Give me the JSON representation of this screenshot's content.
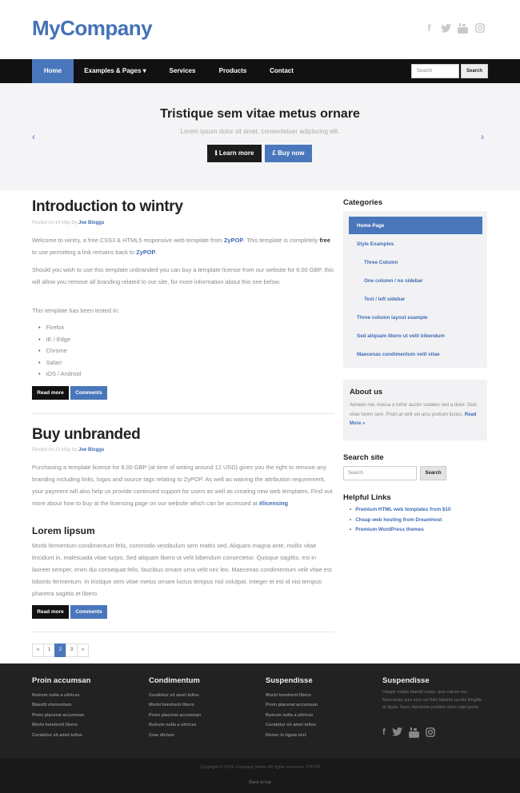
{
  "header": {
    "logo": "MyCompany",
    "social_icons": [
      "facebook-icon",
      "twitter-icon",
      "youtube-icon",
      "instagram-icon"
    ]
  },
  "nav": {
    "items": [
      "Home",
      "Examples & Pages ▾",
      "Services",
      "Products",
      "Contact"
    ],
    "search_placeholder": "Search",
    "search_button": "Search"
  },
  "hero": {
    "title": "Tristique sem vitae metus ornare",
    "subtitle": "Lorem ipsum dolor sit amet, consectetuer adipiscing elit.",
    "learn_more": "ℹ  Learn more",
    "buy_now": "£  Buy now"
  },
  "posts": [
    {
      "title": "Introduction to wintry",
      "meta_prefix": "Posted on 14 May by",
      "author": "Joe Bloggs",
      "p1a": "Welcome to wintry, a free CSS3 & HTML5 responsive web template from ",
      "p1link": "ZyPOP",
      "p1b": ". This template is completely ",
      "p1free": "free",
      "p1c": " to use permitting a link remains back to ",
      "p1link2": "ZyPOP",
      "p1d": ".",
      "p2": "Should you wish to use this template unbranded you can buy a template license from our website for 8.00 GBP, this will allow you remove all branding related to our site, for more information about this see below.",
      "p3": "This template has been tested in:",
      "list": [
        "Firefox",
        "IE / Edge",
        "Chrome",
        "Safari",
        "iOS / Android"
      ],
      "read_more": "Read more",
      "comments": "Comments"
    },
    {
      "title": "Buy unbranded",
      "meta_prefix": "Posted on 13 May by",
      "author": "Joe Bloggs",
      "p1": "Purchasing a template license for 8.00 GBP (at time of writing around 12 USD) gives you the right to remove any branding including links, logos and source tags relating to ZyPOP. As well as waiving the attribution requirement, your payment will also help us provide continued support for users as well as creating new web templates. Find out more about how to buy at the licensing page on our website which can be accessed at ",
      "p1link": "#licensing",
      "subheading": "Lorem lipsum",
      "p2": "Morbi fermentum condimentum felis, commodo vestibulum sem mattis sed. Aliquam magna ante, mollis vitae tincidunt in, malesuada vitae turpis. Sed aliquam libero ut velit bibendum consectetur. Quisque sagittis, est in laoreet semper, enim dui consequat felis, faucibus ornare urna velit nec leo. Maecenas condimentum velit vitae est lobortis fermentum. In tristique sem vitae metus ornare luctus tempus nisl volutpat. Integer et est id nisi tempus pharetra sagittis et libero.",
      "read_more": "Read more",
      "comments": "Comments"
    }
  ],
  "pagination": [
    "«",
    "1",
    "2",
    "3",
    "»"
  ],
  "sidebar": {
    "categories_title": "Categories",
    "categories": [
      "Home Page",
      "Style Examples",
      "Three Column",
      "One column / no sidebar",
      "Text / left sidebar",
      "Three column layout example",
      "Sed aliquam libero ut velit bibendum",
      "Maecenas condimentum velit vitae"
    ],
    "about_title": "About us",
    "about_text": "Aenean nec massa a tortor auctor sodales sed a dolor. Duis vitae lorem sem. Proin at velit vel arcu pretium luctus.",
    "about_link": "Read More »",
    "search_title": "Search site",
    "search_placeholder": "Search",
    "search_button": "Search",
    "links_title": "Helpful Links",
    "links": [
      "Premium HTML web templates from $10",
      "Cheap web hosting from Dreamhost",
      "Premium WordPress themes"
    ]
  },
  "footer": {
    "columns": [
      {
        "title": "Proin accumsan",
        "items": [
          "Rutrum nulla a ultrices",
          "Blandit elementum",
          "Proin placerat accumsan",
          "Morbi hendrerit libero",
          "Curabitur sit amet tellus"
        ]
      },
      {
        "title": "Condimentum",
        "items": [
          "Curabitur sit amet tellus",
          "Morbi hendrerit libero",
          "Proin placerat accumsan",
          "Rutrum nulla a ultrices",
          "Cras dictum"
        ]
      },
      {
        "title": "Suspendisse",
        "items": [
          "Morbi hendrerit libero",
          "Proin placerat accumsan",
          "Rutrum nulla a ultrices",
          "Curabitur sit amet tellus",
          "Donec in ligula nisl."
        ]
      }
    ],
    "col4_title": "Suspendisse",
    "col4_text": "Integer mattis blandit turpis, quis rutrum est. Maecenas quis arcu vel felis lobortis iaculis fringilla at ligula. Nunc dignissim porttitor dolor eget porta.",
    "copyright": "Copyright © 2019 Company Name All rights reserved. ZYPOP",
    "back_to_top": "Back to top"
  }
}
